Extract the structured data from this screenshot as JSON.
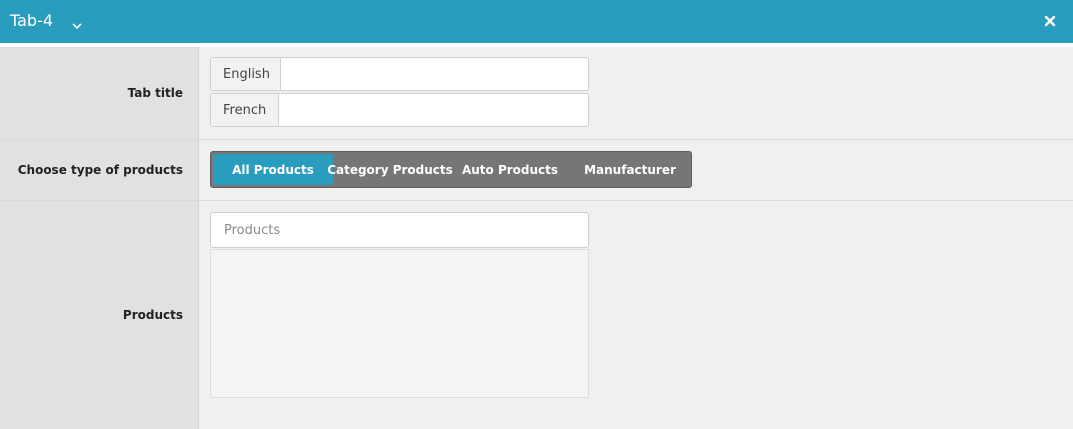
{
  "header": {
    "title": "Tab-4",
    "dropdown_icon": "chevron-down-icon",
    "close_icon": "close-icon",
    "color": "#2a9dbf"
  },
  "tab_title": {
    "label": "Tab title",
    "languages": [
      {
        "label": "English",
        "value": ""
      },
      {
        "label": "French",
        "value": ""
      }
    ]
  },
  "product_type": {
    "label": "Choose type of products",
    "options": [
      "All Products",
      "Category Products",
      "Auto Products",
      "Manufacturer"
    ],
    "selected": "All Products"
  },
  "products": {
    "label": "Products",
    "placeholder": "Products",
    "items": []
  }
}
